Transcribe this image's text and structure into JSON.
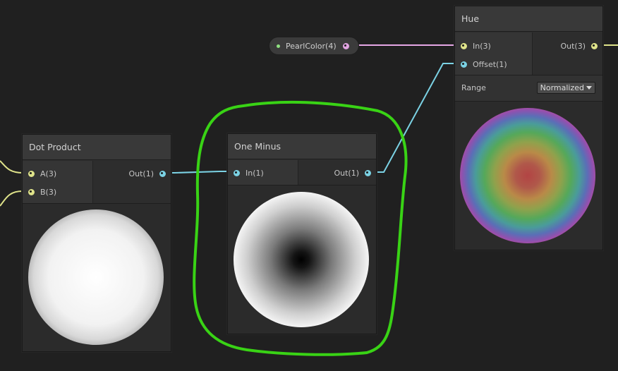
{
  "pearl_color": {
    "label": "PearlColor(4)"
  },
  "dot_product": {
    "title": "Dot Product",
    "inputs": [
      {
        "label": "A(3)"
      },
      {
        "label": "B(3)"
      }
    ],
    "output": {
      "label": "Out(1)"
    }
  },
  "one_minus": {
    "title": "One Minus",
    "input": {
      "label": "In(1)"
    },
    "output": {
      "label": "Out(1)"
    }
  },
  "hue": {
    "title": "Hue",
    "inputs": [
      {
        "label": "In(3)"
      },
      {
        "label": "Offset(1)"
      }
    ],
    "output": {
      "label": "Out(3)"
    },
    "range_label": "Range",
    "range_value": "Normalized"
  },
  "colors": {
    "vector3_port": "#dfe38a",
    "vector1_port": "#7bd2e4",
    "vector4_port": "#e0a3e0",
    "highlight_annotation": "#39d315"
  }
}
